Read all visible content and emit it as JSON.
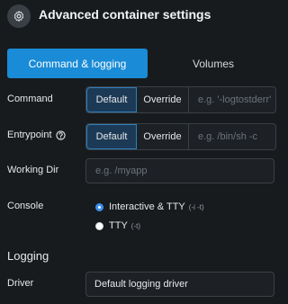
{
  "header": {
    "title": "Advanced container settings",
    "icon": "gear-icon"
  },
  "tabs": [
    {
      "label": "Command & logging",
      "active": true
    },
    {
      "label": "Volumes",
      "active": false
    }
  ],
  "command": {
    "label": "Command",
    "default_label": "Default",
    "override_label": "Override",
    "placeholder": "e.g. '-logtostderr'"
  },
  "entrypoint": {
    "label": "Entrypoint",
    "default_label": "Default",
    "override_label": "Override",
    "placeholder": "e.g. /bin/sh -c"
  },
  "working_dir": {
    "label": "Working Dir",
    "placeholder": "e.g. /myapp"
  },
  "console": {
    "label": "Console",
    "options": [
      {
        "label": "Interactive & TTY",
        "hint": "(-i -t)",
        "selected": true
      },
      {
        "label": "TTY",
        "hint": "(-t)",
        "selected": false
      }
    ]
  },
  "logging": {
    "title": "Logging",
    "driver_label": "Driver",
    "driver_value": "Default logging driver"
  },
  "colors": {
    "accent": "#1a8bd6",
    "background": "#181b1e"
  }
}
